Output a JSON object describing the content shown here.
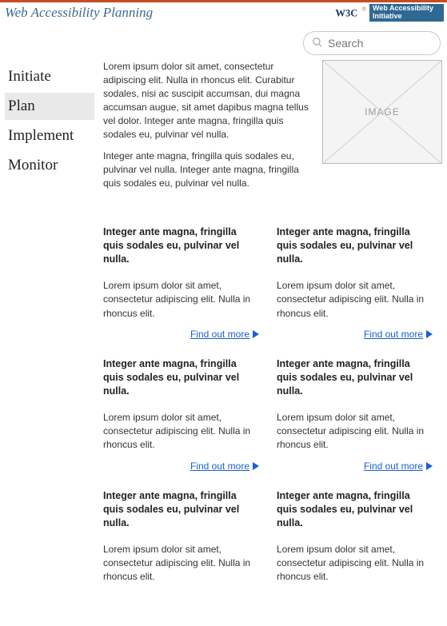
{
  "header": {
    "site_title": "Web Accessibility Planning",
    "logo_w3c_alt": "W3C",
    "logo_wai_line1": "Web Accessibility",
    "logo_wai_line2": "Initiative"
  },
  "search": {
    "placeholder": "Search"
  },
  "sidenav": [
    {
      "label": "Initiate"
    },
    {
      "label": "Plan"
    },
    {
      "label": "Implement"
    },
    {
      "label": "Monitor"
    }
  ],
  "intro": {
    "p1": "Lorem ipsum dolor sit amet, consectetur adipiscing elit. Nulla in rhoncus elit. Curabitur sodales, nisi ac suscipit accumsan, dui magna accumsan augue, sit amet dapibus magna tellus vel dolor. Integer ante magna, fringilla quis sodales eu, pulvinar vel nulla.",
    "p2": "Integer ante magna, fringilla quis sodales eu, pulvinar vel nulla. Integer ante magna, fringilla quis sodales eu, pulvinar vel nulla.",
    "image_label": "IMAGE"
  },
  "cards": [
    {
      "title": "Integer ante magna, fringilla quis sodales eu, pulvinar vel nulla.",
      "body": "Lorem ipsum dolor sit amet, consectetur adipiscing elit. Nulla in rhoncus elit.",
      "more": "Find out more"
    },
    {
      "title": "Integer ante magna, fringilla quis sodales eu, pulvinar vel nulla.",
      "body": "Lorem ipsum dolor sit amet, consectetur adipiscing elit. Nulla in rhoncus elit.",
      "more": "Find out more"
    },
    {
      "title": "Integer ante magna, fringilla quis sodales eu, pulvinar vel nulla.",
      "body": "Lorem ipsum dolor sit amet, consectetur adipiscing elit. Nulla in rhoncus elit.",
      "more": "Find out more"
    },
    {
      "title": "Integer ante magna, fringilla quis sodales eu, pulvinar vel nulla.",
      "body": "Lorem ipsum dolor sit amet, consectetur adipiscing elit. Nulla in rhoncus elit.",
      "more": "Find out more"
    },
    {
      "title": "Integer ante magna, fringilla quis sodales eu, pulvinar vel nulla.",
      "body": "Lorem ipsum dolor sit amet, consectetur adipiscing elit. Nulla in rhoncus elit."
    },
    {
      "title": "Integer ante magna, fringilla quis sodales eu, pulvinar vel nulla.",
      "body": "Lorem ipsum dolor sit amet, consectetur adipiscing elit. Nulla in rhoncus elit."
    }
  ],
  "colors": {
    "accent": "#c44d25",
    "link": "#1a5fd6",
    "brand_blue": "#2f6893"
  }
}
